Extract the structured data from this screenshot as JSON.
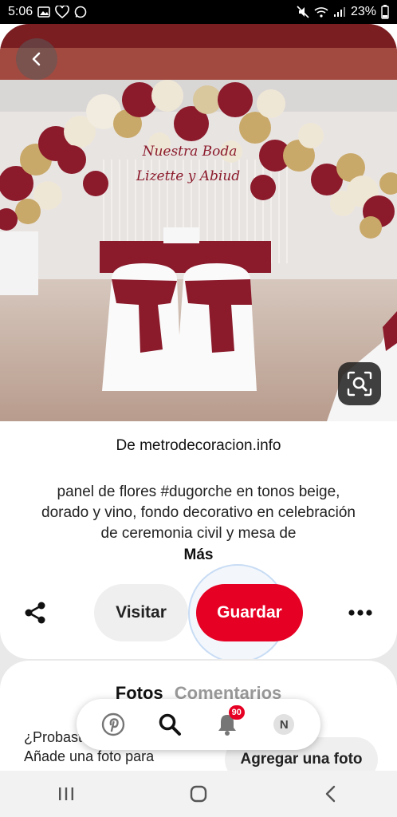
{
  "status_bar": {
    "time": "5:06",
    "battery": "23%"
  },
  "pin": {
    "source_prefix": "De",
    "source_domain": "metrodecoracion.info",
    "description": "panel de flores #dugorche en tonos beige, dorado y vino, fondo decorativo en celebración de ceremonia civil y mesa de",
    "more_label": "Más",
    "image_sign_text_1": "Nuestra Boda",
    "image_sign_text_2": "Lizette y Abiud"
  },
  "actions": {
    "visit_label": "Visitar",
    "save_label": "Guardar"
  },
  "comments_section": {
    "tab_photos": "Fotos",
    "tab_comments": "Comentarios",
    "prompt_line1": "¿Probaste este Pin?",
    "prompt_line2": "Añade una foto para",
    "add_photo_label": "Agregar una foto"
  },
  "bottom_nav": {
    "notification_count": "90",
    "avatar_initial": "N"
  },
  "colors": {
    "brand_red": "#e60023",
    "wine": "#8b1a2b"
  }
}
